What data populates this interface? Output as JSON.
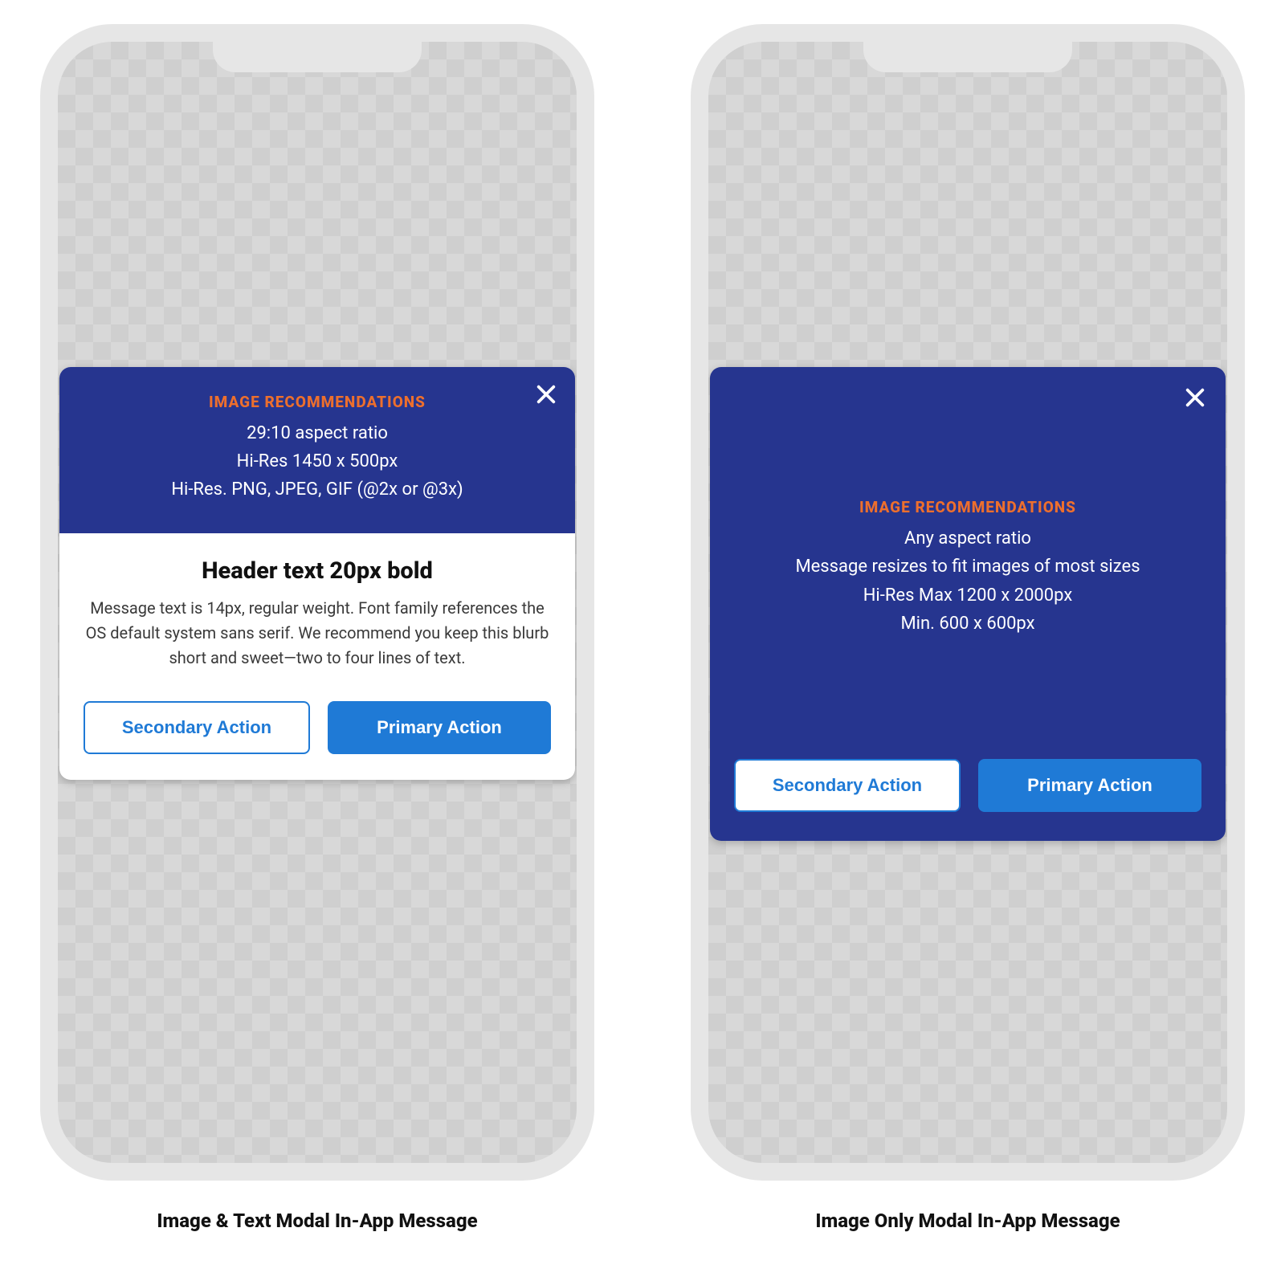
{
  "modalA": {
    "caption": "Image & Text Modal In-App Message",
    "hero": {
      "title": "IMAGE RECOMMENDATIONS",
      "line1": "29:10 aspect ratio",
      "line2": "Hi-Res 1450 x 500px",
      "line3": "Hi-Res. PNG, JPEG, GIF (@2x or @3x)"
    },
    "header": "Header text 20px bold",
    "message": "Message text is 14px, regular weight. Font family references the OS default system sans serif. We recommend you keep this blurb short and sweet—two to four lines of text.",
    "secondary": "Secondary Action",
    "primary": "Primary Action"
  },
  "modalB": {
    "caption": "Image Only Modal In-App Message",
    "hero": {
      "title": "IMAGE RECOMMENDATIONS",
      "line1": "Any aspect ratio",
      "line2": "Message resizes to fit images of most sizes",
      "line3": "Hi-Res Max 1200 x 2000px",
      "line4": "Min. 600 x 600px"
    },
    "secondary": "Secondary Action",
    "primary": "Primary Action"
  }
}
